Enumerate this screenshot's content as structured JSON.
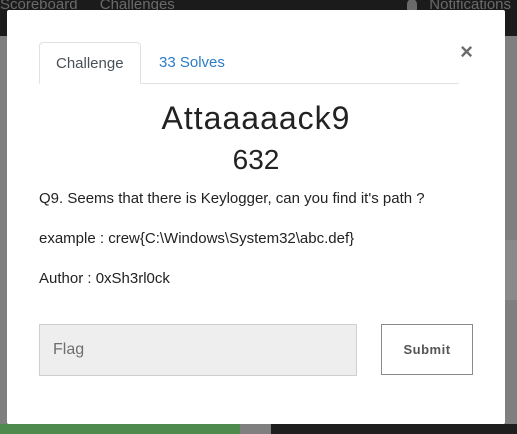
{
  "navbar": {
    "items": [
      "Scoreboard",
      "Challenges"
    ],
    "notifications_label": "Notifications"
  },
  "modal": {
    "tabs": [
      {
        "label": "Challenge",
        "active": true
      },
      {
        "label": "33 Solves",
        "active": false
      }
    ],
    "close_label": "×",
    "title": "Attaaaaack9",
    "points": "632",
    "description": [
      "Q9. Seems that there is Keylogger, can you find it's path ?",
      "example : crew{C:\\Windows\\System32\\abc.def}",
      "Author : 0xSh3rl0ck"
    ],
    "flag_placeholder": "Flag",
    "flag_value": "",
    "submit_label": "Submit"
  },
  "colors": {
    "tab_link": "#2b7bc9",
    "overlay": "#7f7f7f"
  }
}
